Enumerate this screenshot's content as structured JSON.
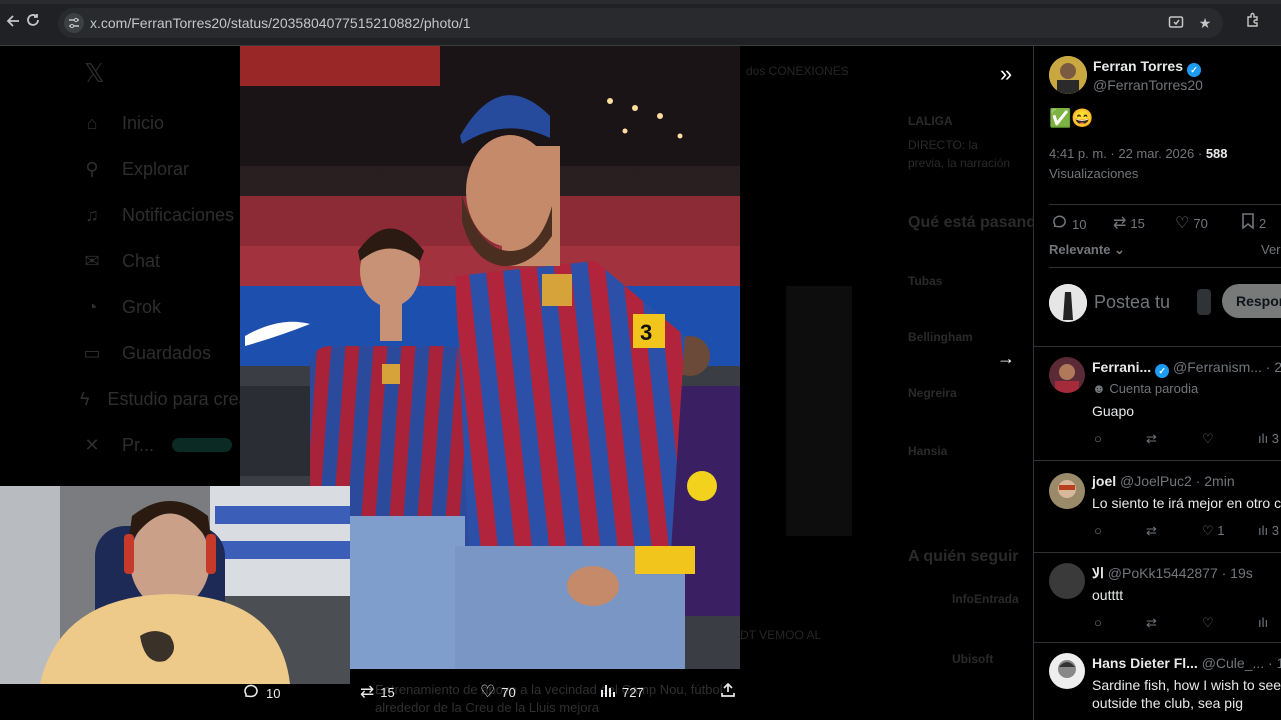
{
  "browser": {
    "url": "x.com/FerranTorres20/status/2035804077515210882/photo/1",
    "icons": [
      "back-icon",
      "reload-icon",
      "site-info-icon",
      "cast-icon",
      "bookmark-star-icon",
      "extensions-icon"
    ]
  },
  "background": {
    "nav": [
      {
        "icon": "home-icon",
        "label": "Inicio"
      },
      {
        "icon": "search-icon",
        "label": "Explorar"
      },
      {
        "icon": "bell-icon",
        "label": "Notificaciones"
      },
      {
        "icon": "mail-icon",
        "label": "Chat"
      },
      {
        "icon": "grok-icon",
        "label": "Grok"
      },
      {
        "icon": "bookmark-icon",
        "label": "Guardados"
      },
      {
        "icon": "lightning-icon",
        "label": "Estudio para creadores"
      },
      {
        "icon": "x-logo-icon",
        "label": "Pr..."
      }
    ],
    "right_column": {
      "liga_label": "LALIGA",
      "liga_text_1": "DIRECTO: la",
      "liga_text_2": "previa, la narración",
      "trending_title": "Qué está pasando",
      "trends": [
        "Tubas",
        "Bellingham",
        "Negreira",
        "Hansia"
      ],
      "who_to_follow_title": "A quién seguir",
      "suggested": [
        "InfoEntrada",
        "Ubisoft"
      ],
      "center_text_1": "dos CONEXIONES",
      "center_text_2": "DT VEMOO AL"
    },
    "caption_1": "Entrenamiento de apoyo a la vecindad del Camp Nou, fútbol",
    "caption_2": "alrededor de la Creu de la Lluis mejora"
  },
  "photo": {
    "alt": "Two football players in blue and red striped long sleeve shirts walking in a stadium",
    "armband_number": "3"
  },
  "action_bar": {
    "replies": "10",
    "reposts": "15",
    "likes": "70",
    "views": "727"
  },
  "tweet": {
    "author_name": "Ferran Torres",
    "author_handle": "@FerranTorres20",
    "text": "✅😄",
    "time": "4:41 p. m. · 22 mar. 2026 ·",
    "views_count": "588",
    "views_label": "Visualizaciones",
    "stats": {
      "replies": "10",
      "reposts": "15",
      "likes": "70",
      "bookmarks": "2"
    },
    "sort_label": "Relevante",
    "sort_right": "Ver",
    "reply_placeholder": "Postea tu",
    "reply_button": "Respon"
  },
  "replies": [
    {
      "name": "Ferrani...",
      "handle": "@Ferranism... · 2m",
      "badge": "Cuenta parodia",
      "text": "Guapo",
      "likes": "",
      "views": "3"
    },
    {
      "name": "joel",
      "handle": "@JoelPuc2 · 2min",
      "text": "Lo siento te irá mejor en otro c",
      "likes": "1",
      "views": "3"
    },
    {
      "name": "الا",
      "handle": "@PoKk15442877 · 19s",
      "text": "outttt",
      "likes": "",
      "views": ""
    },
    {
      "name": "Hans Dieter Fl...",
      "handle": "@Cule_... · 1m",
      "text": "Sardine fish, how I wish to see",
      "text2": "outside the club, sea pig"
    }
  ],
  "colors": {
    "accent": "#1d9bf0",
    "kit_blue": "#2c4fa8",
    "kit_red": "#b2243c",
    "armband": "#f2c51d"
  }
}
